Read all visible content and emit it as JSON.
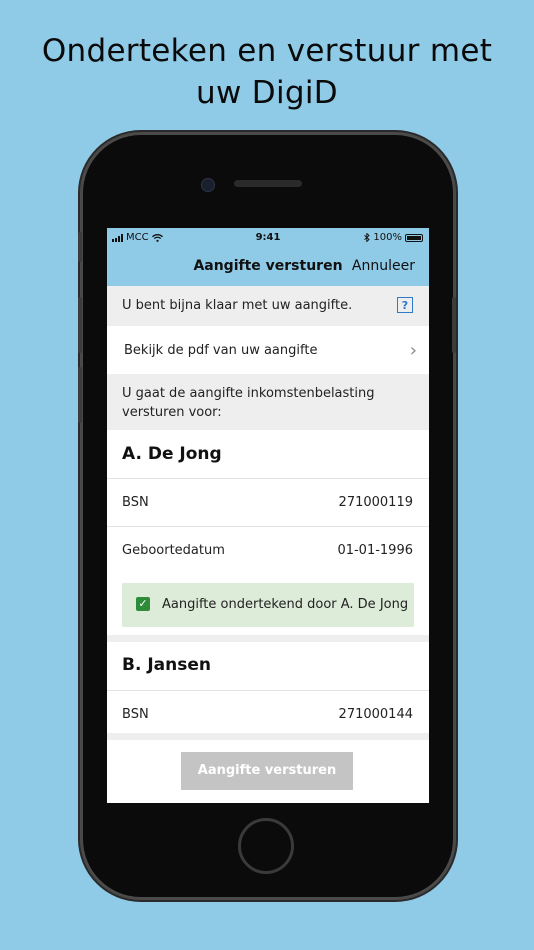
{
  "headline": [
    "Onderteken en verstuur met",
    "uw DigiD"
  ],
  "status": {
    "carrier": "MCC",
    "time": "9:41",
    "bluetooth": "bluetooth-icon",
    "battery": "100%"
  },
  "nav": {
    "title": "Aangifte versturen",
    "cancel": "Annuleer"
  },
  "info": {
    "text": "U bent bijna klaar met uw aangifte.",
    "help": "?"
  },
  "pdf_row": {
    "label": "Bekijk de pdf van uw aangifte",
    "chevron": "›"
  },
  "intro": "U gaat de aangifte inkomstenbelasting versturen voor:",
  "persons": [
    {
      "name": "A. De Jong",
      "bsn_label": "BSN",
      "bsn": "271000119",
      "dob_label": "Geboortedatum",
      "dob": "01-01-1996",
      "signed_text": "Aangifte ondertekend door A. De Jong"
    },
    {
      "name": "B. Jansen",
      "bsn_label": "BSN",
      "bsn": "271000144"
    }
  ],
  "send_button": "Aangifte versturen",
  "colors": {
    "background": "#8fcae6",
    "signed_bg": "#dcecd9",
    "check": "#2e8b3a",
    "help_link": "#2e79c8",
    "disabled_button": "#c4c4c4"
  }
}
